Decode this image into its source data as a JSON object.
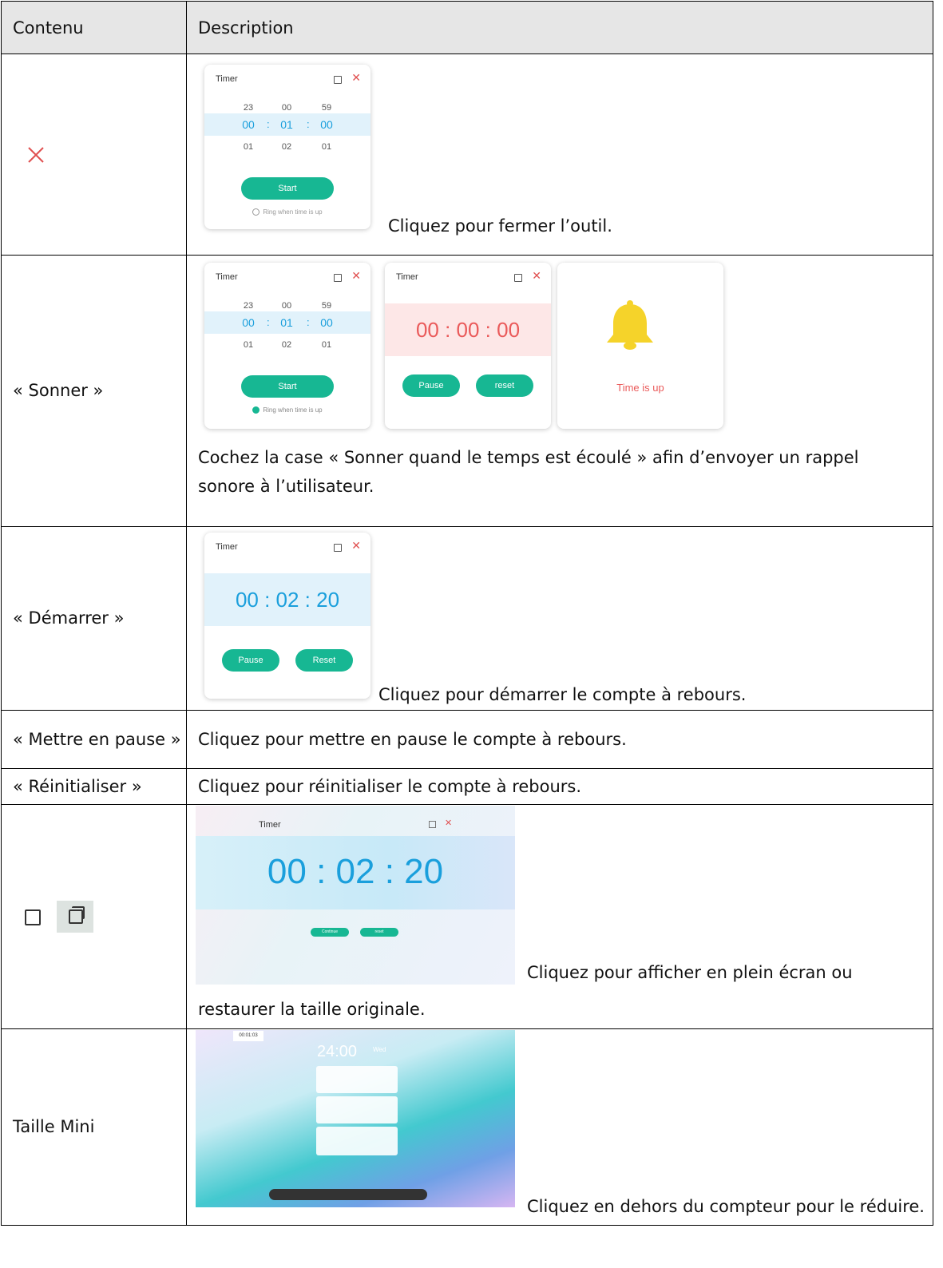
{
  "header": {
    "col1": "Contenu",
    "col2": "Description"
  },
  "rows": [
    {
      "label": "",
      "text": "Cliquez pour fermer l’outil."
    },
    {
      "label": "« Sonner »",
      "text": "Cochez la case « Sonner quand le temps est écoulé » afin d’envoyer un rappel sonore à l’utilisateur."
    },
    {
      "label": "« Démarrer »",
      "text": "Cliquez pour démarrer le compte à rebours."
    },
    {
      "label": "« Mettre en pause »",
      "text": "Cliquez pour mettre en pause le compte à rebours."
    },
    {
      "label": "« Réinitialiser »",
      "text": "Cliquez pour réinitialiser le compte à rebours."
    },
    {
      "label": "",
      "text1": "Cliquez pour afficher en plein écran ou",
      "text2": "restaurer la taille originale."
    },
    {
      "label": "Taille Mini",
      "text": "Cliquez en dehors du compteur pour le réduire."
    }
  ],
  "timer": {
    "title": "Timer",
    "start": "Start",
    "ring": "Ring when time is up",
    "above": [
      "23",
      "00",
      "59"
    ],
    "selected": [
      "00",
      "01",
      "00"
    ],
    "below": [
      "01",
      "02",
      "01"
    ],
    "sep": ":",
    "running1": "00 : 00 : 00",
    "running2": "00 : 02 : 20",
    "pause": "Pause",
    "reset_lower": "reset",
    "reset_cap": "Reset",
    "time_up": "Time is up",
    "fs_time": "00 : 02 : 20",
    "fs_continue": "Continue",
    "fs_reset": "reset"
  },
  "desktop": {
    "clock": "24:00",
    "day": "Wed",
    "mini_timer": "00:01:03"
  },
  "colors": {
    "accent": "#17b793",
    "blue": "#1a9fdc",
    "red": "#e05050",
    "bell": "#f5d32a"
  }
}
